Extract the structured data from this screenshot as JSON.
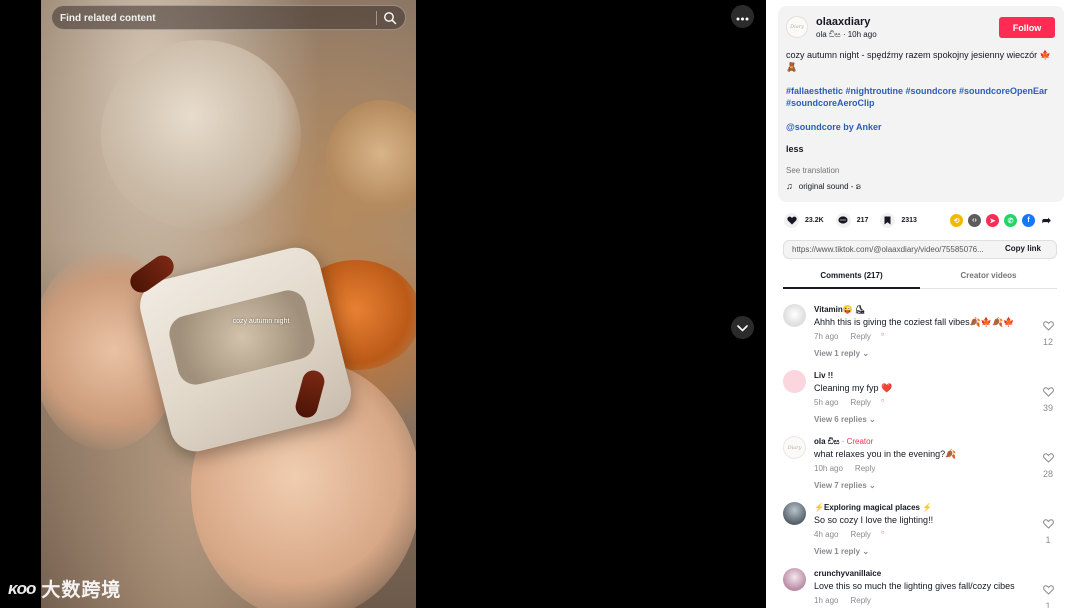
{
  "search": {
    "placeholder": "Find related content"
  },
  "video": {
    "caption": "cozy autumn night"
  },
  "watermark": {
    "logo": "ᴋᴏᴏ",
    "text": "大数跨境"
  },
  "author": {
    "avatar_text": "Diary",
    "username": "olaaxdiary",
    "display_name": "ola ඩිස",
    "time_ago": "10h ago",
    "follow_label": "Follow"
  },
  "post": {
    "caption": "cozy autumn night - spędźmy razem spokojny jesienny wieczór 🍁🧸",
    "hashtags": "#fallaesthetic #nightroutine #soundcore #soundcoreOpenEar #soundcoreAeroClip",
    "mention": "@soundcore by Anker",
    "less_label": "less",
    "see_translation": "See translation",
    "sound": "original sound - ຣ"
  },
  "stats": {
    "likes": "23.2K",
    "comments": "217",
    "saves": "2313"
  },
  "share": {
    "url": "https://www.tiktok.com/@olaaxdiary/video/75585076...",
    "copy_label": "Copy link"
  },
  "tabs": {
    "comments": "Comments (217)",
    "creator": "Creator videos"
  },
  "colors": {
    "accent": "#fe2c55",
    "link": "#2b5db9"
  },
  "comments": [
    {
      "name": "Vitamin😜 ⛸",
      "text": "Ahhh this is giving the coziest fall vibes🍂🍁🍂🍁",
      "time": "7h ago",
      "reply": "Reply",
      "replies": "View 1 reply",
      "likes": "12"
    },
    {
      "name": "Liv !!",
      "text": "Cleaning my fyp ❤️",
      "time": "5h ago",
      "reply": "Reply",
      "replies": "View 6 replies",
      "likes": "39"
    },
    {
      "name": "ola ඩිස",
      "creator": "· Creator",
      "text": "what relaxes you in the evening?🍂",
      "time": "10h ago",
      "reply": "Reply",
      "replies": "View 7 replies",
      "likes": "28"
    },
    {
      "name": "⚡Exploring magical places ⚡",
      "text": "So so cozy I love the lighting!!",
      "time": "4h ago",
      "reply": "Reply",
      "replies": "View 1 reply",
      "likes": "1"
    },
    {
      "name": "crunchyvanillaice",
      "text": "Love this so much the lighting gives fall/cozy cibes",
      "time": "1h ago",
      "reply": "Reply",
      "replies": "",
      "likes": "1"
    }
  ]
}
